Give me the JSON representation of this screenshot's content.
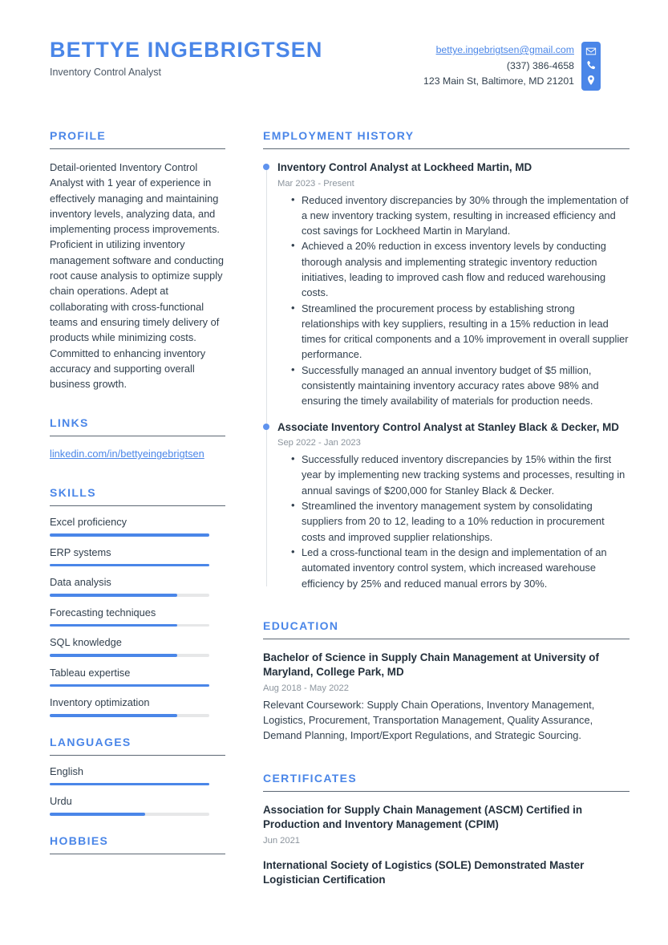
{
  "header": {
    "name": "BETTYE INGEBRIGTSEN",
    "job_title": "Inventory Control Analyst",
    "contact": {
      "email": "bettye.ingebrigtsen@gmail.com",
      "phone": "(337) 386-4658",
      "address": "123 Main St, Baltimore, MD 21201",
      "icons": [
        "envelope-icon",
        "phone-icon",
        "location-pin-icon"
      ]
    }
  },
  "theme": {
    "accent": "#4a86e8",
    "dot": "#5f93ee",
    "text": "#32404e",
    "muted": "#8b949d",
    "rule": "#5c6773",
    "track": "#e6e7e8"
  },
  "left": {
    "profile": {
      "title": "PROFILE",
      "text": "Detail-oriented Inventory Control Analyst with 1 year of experience in effectively managing and maintaining inventory levels, analyzing data, and implementing process improvements. Proficient in utilizing inventory management software and conducting root cause analysis to optimize supply chain operations. Adept at collaborating with cross-functional teams and ensuring timely delivery of products while minimizing costs. Committed to enhancing inventory accuracy and supporting overall business growth."
    },
    "links": {
      "title": "LINKS",
      "items": [
        {
          "label": "linkedin.com/in/bettyeingebrigtsen"
        }
      ]
    },
    "skills": {
      "title": "SKILLS",
      "items": [
        {
          "label": "Excel proficiency",
          "level": 100
        },
        {
          "label": "ERP systems",
          "level": 100
        },
        {
          "label": "Data analysis",
          "level": 80
        },
        {
          "label": "Forecasting techniques",
          "level": 80
        },
        {
          "label": "SQL knowledge",
          "level": 80
        },
        {
          "label": "Tableau expertise",
          "level": 100
        },
        {
          "label": "Inventory optimization",
          "level": 80
        }
      ]
    },
    "languages": {
      "title": "LANGUAGES",
      "items": [
        {
          "label": "English",
          "level": 100
        },
        {
          "label": "Urdu",
          "level": 60
        }
      ]
    },
    "hobbies": {
      "title": "HOBBIES",
      "items": []
    }
  },
  "right": {
    "employment": {
      "title": "EMPLOYMENT HISTORY",
      "entries": [
        {
          "title": "Inventory Control Analyst at Lockheed Martin, MD",
          "date": "Mar 2023 - Present",
          "bullets": [
            "Reduced inventory discrepancies by 30% through the implementation of a new inventory tracking system, resulting in increased efficiency and cost savings for Lockheed Martin in Maryland.",
            "Achieved a 20% reduction in excess inventory levels by conducting thorough analysis and implementing strategic inventory reduction initiatives, leading to improved cash flow and reduced warehousing costs.",
            "Streamlined the procurement process by establishing strong relationships with key suppliers, resulting in a 15% reduction in lead times for critical components and a 10% improvement in overall supplier performance.",
            "Successfully managed an annual inventory budget of $5 million, consistently maintaining inventory accuracy rates above 98% and ensuring the timely availability of materials for production needs."
          ]
        },
        {
          "title": "Associate Inventory Control Analyst at Stanley Black & Decker, MD",
          "date": "Sep 2022 - Jan 2023",
          "bullets": [
            "Successfully reduced inventory discrepancies by 15% within the first year by implementing new tracking systems and processes, resulting in annual savings of $200,000 for Stanley Black & Decker.",
            "Streamlined the inventory management system by consolidating suppliers from 20 to 12, leading to a 10% reduction in procurement costs and improved supplier relationships.",
            "Led a cross-functional team in the design and implementation of an automated inventory control system, which increased warehouse efficiency by 25% and reduced manual errors by 30%."
          ]
        }
      ]
    },
    "education": {
      "title": "EDUCATION",
      "entries": [
        {
          "title": "Bachelor of Science in Supply Chain Management at University of Maryland, College Park, MD",
          "date": "Aug 2018 - May 2022",
          "body": "Relevant Coursework: Supply Chain Operations, Inventory Management, Logistics, Procurement, Transportation Management, Quality Assurance, Demand Planning, Import/Export Regulations, and Strategic Sourcing."
        }
      ]
    },
    "certificates": {
      "title": "CERTIFICATES",
      "entries": [
        {
          "title": "Association for Supply Chain Management (ASCM) Certified in Production and Inventory Management (CPIM)",
          "date": "Jun 2021"
        },
        {
          "title": "International Society of Logistics (SOLE) Demonstrated Master Logistician Certification",
          "date": ""
        }
      ]
    }
  }
}
